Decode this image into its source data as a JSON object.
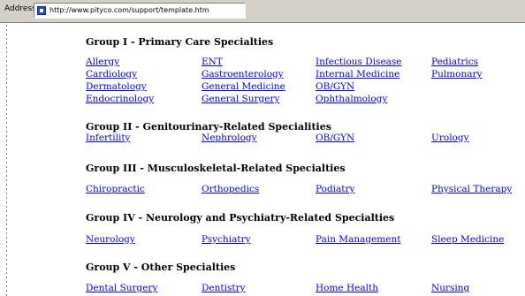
{
  "address_bar": {
    "label": "Address",
    "url": "http://www.pityco.com/support/template.htm"
  },
  "groups": [
    {
      "title": "Group I - Primary Care Specialties",
      "links": [
        "Allergy",
        "ENT",
        "Infectious Disease",
        "Pediatrics",
        "Cardiology",
        "Gastroenterology",
        "Internal Medicine",
        "Pulmonary",
        "Dermatology",
        "General Medicine",
        "OB/GYN",
        "Endocrinology",
        "General Surgery",
        "Ophthalmology"
      ]
    },
    {
      "title": "Group II - Genitourinary-Related Specialities",
      "links": [
        "Infertility",
        "Nephrology",
        "OB/GYN",
        "Urology"
      ]
    },
    {
      "title": "Group III - Musculoskeletal-Related Specialties",
      "links": [
        "Chiropractic",
        "Orthopedics",
        "Podiatry",
        "Physical Therapy"
      ]
    },
    {
      "title": "Group IV - Neurology and Psychiatry-Related Specialties",
      "links": [
        "Neurology",
        "Psychiatry",
        "Pain Management",
        "Sleep Medicine"
      ]
    },
    {
      "title": "Group V - Other Specialties",
      "links": [
        "Dental Surgery",
        "Dentistry",
        "Home Health",
        "Nursing"
      ]
    }
  ]
}
